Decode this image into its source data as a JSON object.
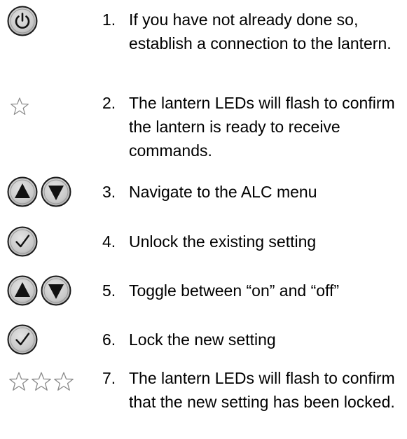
{
  "steps": [
    {
      "number": "1.",
      "text": "If you have not already done so, establish a connection to the lantern.",
      "icons": [
        "power-button-icon"
      ]
    },
    {
      "number": "2.",
      "text": "The lantern LEDs will flash to confirm the lantern is ready to receive commands.",
      "icons": [
        "star-icon"
      ]
    },
    {
      "number": "3.",
      "text": "Navigate to the ALC menu",
      "icons": [
        "up-arrow-button-icon",
        "down-arrow-button-icon"
      ]
    },
    {
      "number": "4.",
      "text": "Unlock the existing setting",
      "icons": [
        "check-button-icon"
      ]
    },
    {
      "number": "5.",
      "text": "Toggle between “on” and “off”",
      "icons": [
        "up-arrow-button-icon",
        "down-arrow-button-icon"
      ]
    },
    {
      "number": "6.",
      "text": "Lock the new setting",
      "icons": [
        "check-button-icon"
      ]
    },
    {
      "number": "7.",
      "text": "The lantern LEDs will flash to confirm that the new setting has been locked.",
      "icons": [
        "star-icon",
        "star-icon",
        "star-icon"
      ]
    }
  ]
}
